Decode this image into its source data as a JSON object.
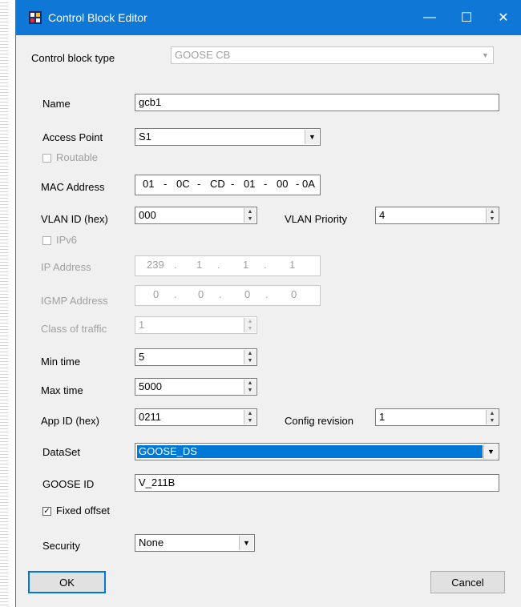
{
  "window": {
    "title": "Control Block Editor"
  },
  "fields": {
    "control_block_type": {
      "label": "Control block type",
      "value": "GOOSE CB"
    },
    "name": {
      "label": "Name",
      "value": "gcb1"
    },
    "access_point": {
      "label": "Access Point",
      "value": "S1"
    },
    "routable": {
      "label": "Routable",
      "checked": false
    },
    "mac_address": {
      "label": "MAC Address",
      "octets": [
        "01",
        "0C",
        "CD",
        "01",
        "00",
        "0A"
      ],
      "separator": "-"
    },
    "vlan_id": {
      "label": "VLAN ID (hex)",
      "value": "000"
    },
    "vlan_priority": {
      "label": "VLAN Priority",
      "value": "4"
    },
    "ipv6": {
      "label": "IPv6",
      "checked": false
    },
    "ip_address": {
      "label": "IP Address",
      "octets": [
        "239",
        "1",
        "1",
        "1"
      ]
    },
    "igmp_address": {
      "label": "IGMP Address",
      "octets": [
        "0",
        "0",
        "0",
        "0"
      ]
    },
    "class_of_traffic": {
      "label": "Class of traffic",
      "value": "1"
    },
    "min_time": {
      "label": "Min time",
      "value": "5"
    },
    "max_time": {
      "label": "Max time",
      "value": "5000"
    },
    "app_id": {
      "label": "App ID (hex)",
      "value": "0211"
    },
    "config_revision": {
      "label": "Config revision",
      "value": "1"
    },
    "dataset": {
      "label": "DataSet",
      "value": "GOOSE_DS"
    },
    "goose_id": {
      "label": "GOOSE ID",
      "value": "V_211B"
    },
    "fixed_offset": {
      "label": "Fixed offset",
      "checked": true
    },
    "security": {
      "label": "Security",
      "value": "None"
    }
  },
  "buttons": {
    "ok": "OK",
    "cancel": "Cancel"
  },
  "glyphs": {
    "minimize": "—",
    "maximize": "☐",
    "close": "✕",
    "dropdown": "▼",
    "spin_up": "▲",
    "spin_down": "▼",
    "check": "✓",
    "dot": "."
  },
  "colors": {
    "titlebar": "#0f78d7",
    "selection": "#0078d7"
  }
}
